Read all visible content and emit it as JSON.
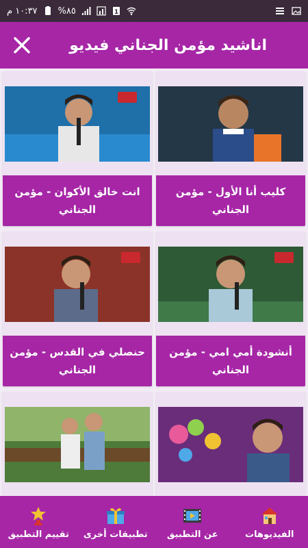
{
  "status_bar": {
    "time": "١٠:٣٧ م",
    "battery": "%٨٥",
    "notification_count": "1"
  },
  "app_bar": {
    "title": "اناشيد مؤمن الجناني فيديو"
  },
  "videos": [
    {
      "title": "كليب أنا الأول - مؤمن الجناني"
    },
    {
      "title": "انت خالق الأكوان - مؤمن الجناني"
    },
    {
      "title": "أنشودة أمي امي - مؤمن الجناني"
    },
    {
      "title": "حنصلي في القدس - مؤمن الجناني"
    }
  ],
  "bottom_nav": [
    {
      "label": "الفيديوهات",
      "icon": "house-icon"
    },
    {
      "label": "عن التطبيق",
      "icon": "film-icon"
    },
    {
      "label": "تطبيقات أخرى",
      "icon": "gift-icon"
    },
    {
      "label": "تقييم التطبيق",
      "icon": "trophy-icon"
    }
  ],
  "colors": {
    "primary": "#a626a6",
    "card_bg": "#eee2f2",
    "page_bg": "#f2ebf5"
  }
}
